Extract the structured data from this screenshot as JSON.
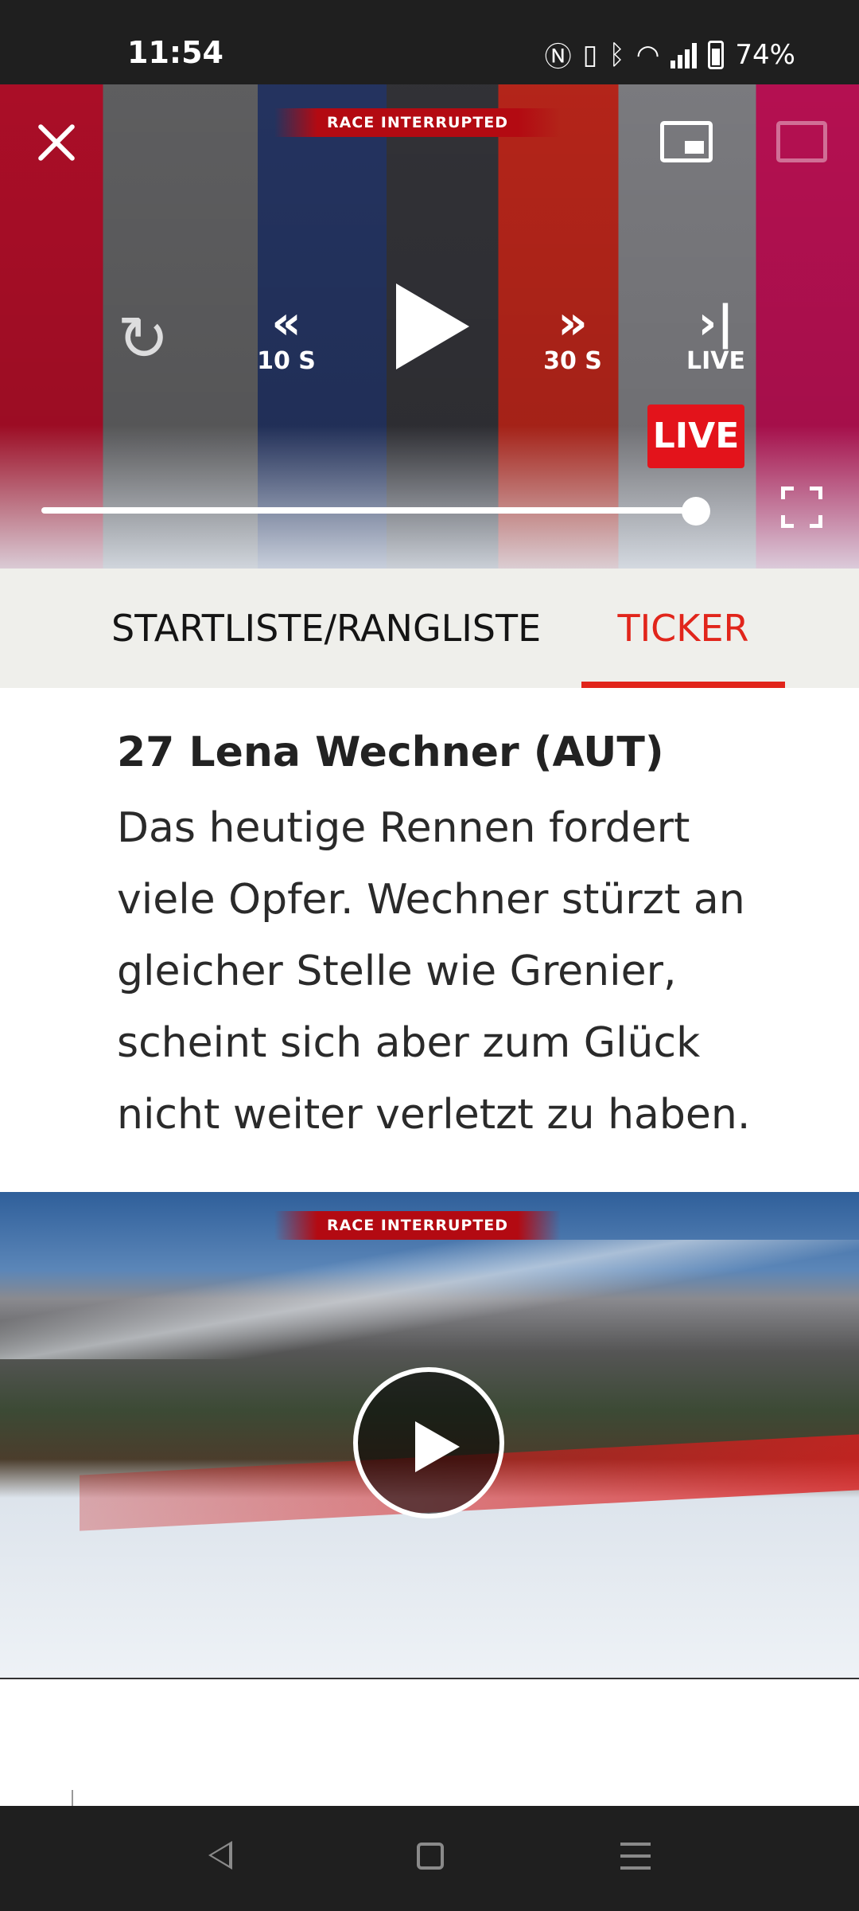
{
  "status_bar": {
    "time": "11:54",
    "battery": "74%",
    "icons": [
      "nfc-icon",
      "vibrate-icon",
      "bluetooth-icon",
      "wifi-icon",
      "signal-icon",
      "battery-icon"
    ]
  },
  "player": {
    "banner": "RACE INTERRUPTED",
    "rewind_label": "10 S",
    "forward_label": "30 S",
    "skip_live_label": "LIVE",
    "live_badge": "LIVE",
    "progress": 0.93,
    "icons": [
      "close-icon",
      "picture-in-picture-icon",
      "cast-icon",
      "replay-icon",
      "rewind-icon",
      "play-icon",
      "fast-forward-icon",
      "skip-to-live-icon",
      "fullscreen-icon"
    ],
    "colors": {
      "live": "#e3131b"
    }
  },
  "tabs": {
    "items": [
      {
        "label": "STARTLISTE/RANGLISTE",
        "active": false
      },
      {
        "label": "TICKER",
        "active": true
      }
    ],
    "active_color": "#e1251b"
  },
  "ticker_entry": {
    "title": "27 Lena Wechner (AUT)",
    "body": "Das heutige Rennen fordert viele Opfer. Wechner stürzt an gleicher Stelle wie Grenier, scheint sich aber zum Glück nicht weiter verletzt zu haben."
  },
  "video2": {
    "banner": "RACE INTERRUPTED",
    "icon": "play-circle-icon"
  },
  "navbar": {
    "icons": [
      "back-icon",
      "home-icon",
      "recents-icon"
    ]
  }
}
